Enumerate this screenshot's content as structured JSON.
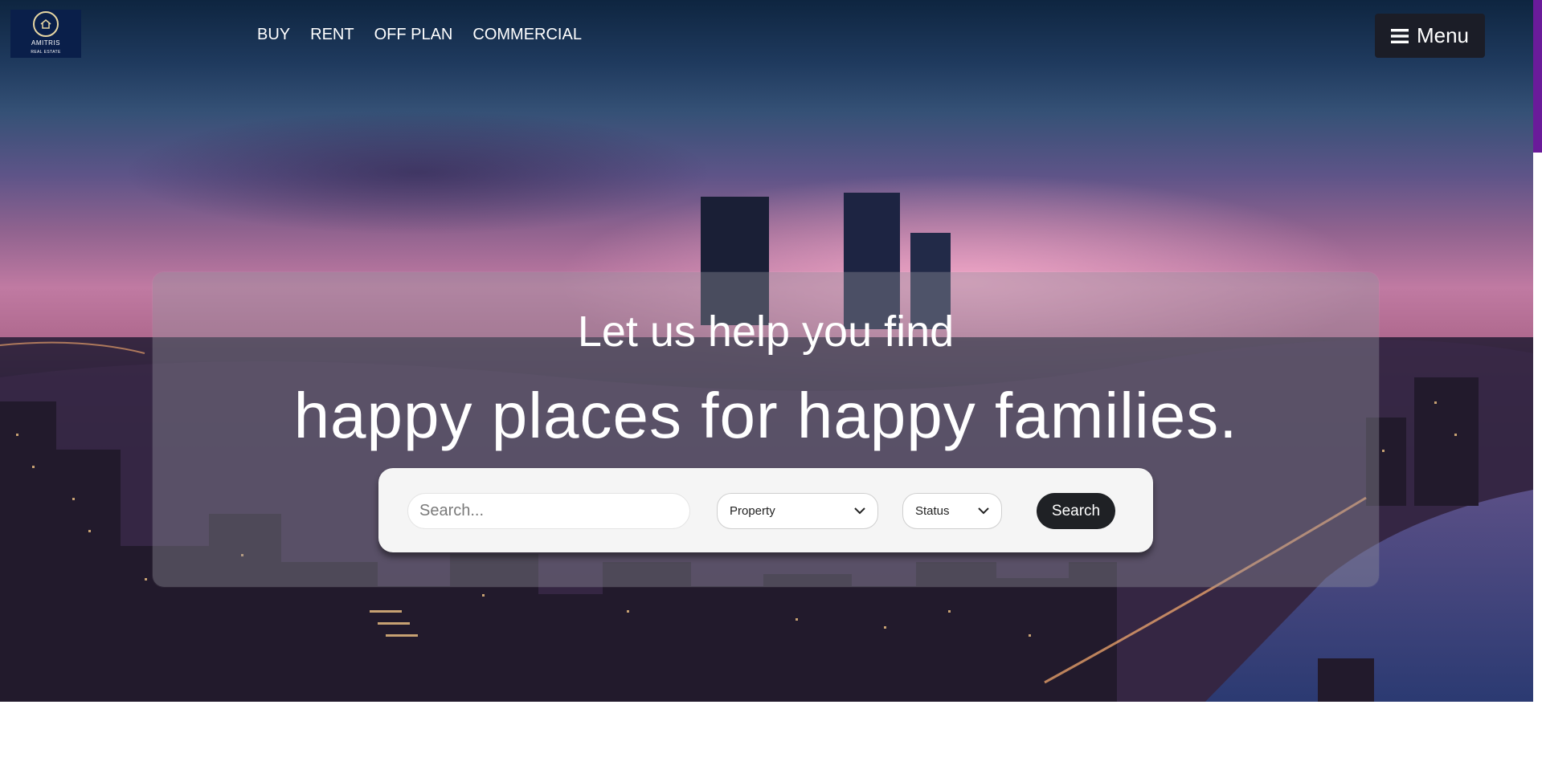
{
  "brand": {
    "logo_name": "AMITRIS",
    "logo_sub": "REAL ESTATE"
  },
  "nav": {
    "items": [
      "BUY",
      "RENT",
      "OFF PLAN",
      "COMMERCIAL"
    ]
  },
  "menu": {
    "label": "Menu",
    "icon": "hamburger-icon"
  },
  "hero": {
    "line1": "Let us help you find",
    "line2": "happy places for happy families."
  },
  "search": {
    "placeholder": "Search...",
    "property_value": "Property",
    "status_value": "Status",
    "button_label": "Search",
    "chevron_icon": "chevron-down-icon"
  },
  "colors": {
    "logo_bg": "#0a1f4a",
    "menu_bg": "#1b1d27",
    "search_button_bg": "#1f2125",
    "scrollbar_thumb": "#6a1b9a"
  }
}
